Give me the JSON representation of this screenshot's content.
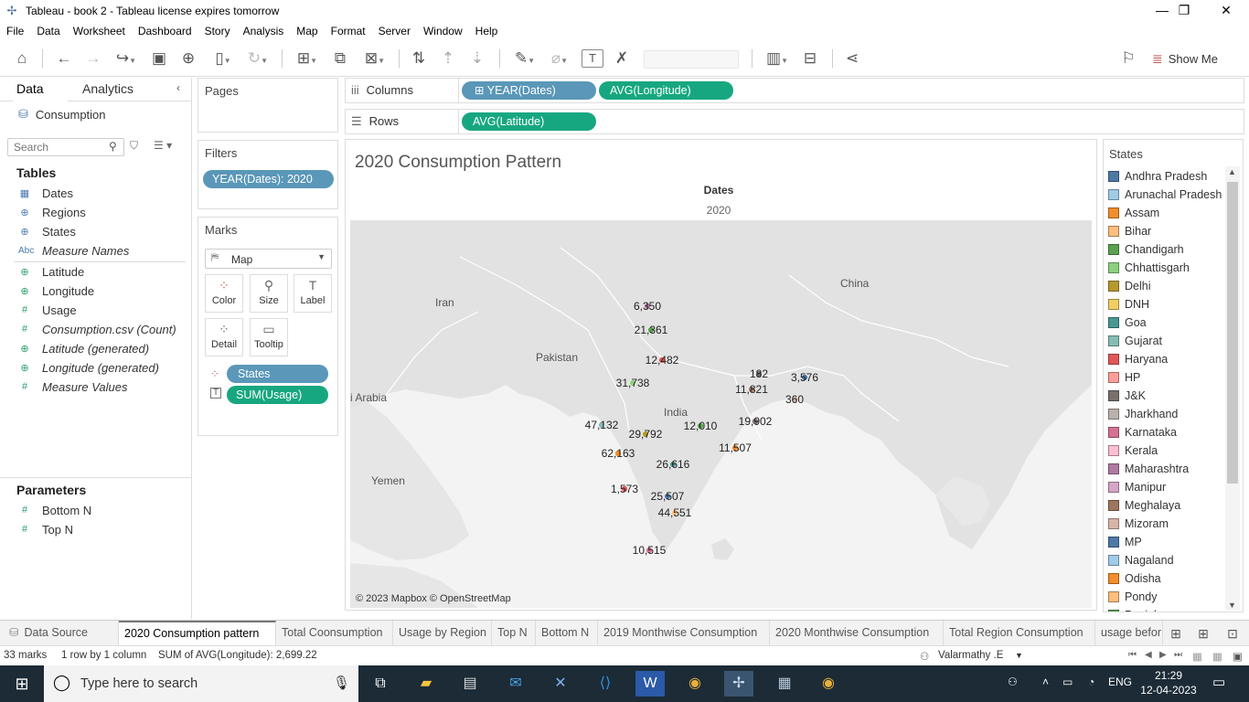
{
  "window": {
    "title": "Tableau - book 2 - Tableau license expires tomorrow",
    "minimize": "—",
    "restore": "❐",
    "close": "✕"
  },
  "menu": [
    "File",
    "Data",
    "Worksheet",
    "Dashboard",
    "Story",
    "Analysis",
    "Map",
    "Format",
    "Server",
    "Window",
    "Help"
  ],
  "toolbar": {
    "show_me": "Show Me"
  },
  "data_pane": {
    "tabs": [
      "Data",
      "Analytics"
    ],
    "source": "Consumption",
    "search_placeholder": "Search",
    "tables_title": "Tables",
    "fields": [
      {
        "name": "Dates",
        "icon": "calendar-icon"
      },
      {
        "name": "Regions",
        "icon": "globe-icon"
      },
      {
        "name": "States",
        "icon": "globe-icon"
      },
      {
        "name": "Measure Names",
        "icon": "abc-icon"
      },
      {
        "name": "Latitude",
        "icon": "globe-icon"
      },
      {
        "name": "Longitude",
        "icon": "globe-icon"
      },
      {
        "name": "Usage",
        "icon": "hash-icon"
      },
      {
        "name": "Consumption.csv (Count)",
        "icon": "hash-icon"
      },
      {
        "name": "Latitude (generated)",
        "icon": "globe-icon"
      },
      {
        "name": "Longitude (generated)",
        "icon": "globe-icon"
      },
      {
        "name": "Measure Values",
        "icon": "hash-icon"
      }
    ],
    "parameters_title": "Parameters",
    "parameters": [
      "Bottom N",
      "Top N"
    ]
  },
  "cards": {
    "pages": "Pages",
    "filters": "Filters",
    "filter_pill": "YEAR(Dates): 2020",
    "marks": "Marks",
    "mark_type": "Map",
    "mark_buttons": [
      "Color",
      "Size",
      "Label",
      "Detail",
      "Tooltip"
    ],
    "mark_pills": [
      "States",
      "SUM(Usage)"
    ]
  },
  "shelves": {
    "columns_label": "Columns",
    "rows_label": "Rows",
    "columns": [
      "YEAR(Dates)",
      "AVG(Longitude)"
    ],
    "rows": [
      "AVG(Latitude)"
    ]
  },
  "viz": {
    "title": "2020 Consumption Pattern",
    "header": "Dates",
    "header_value": "2020",
    "credit": "© 2023 Mapbox © OpenStreetMap",
    "map_labels": [
      "Iran",
      "Pakistan",
      "China",
      "India",
      "i Arabia",
      "Yemen"
    ],
    "marks": [
      {
        "label": "6,350",
        "color": "#b07aa1"
      },
      {
        "label": "21,361",
        "color": "#59a14f"
      },
      {
        "label": "12,482",
        "color": "#e15759"
      },
      {
        "label": "31,738",
        "color": "#8cd17d"
      },
      {
        "label": "182",
        "color": "#79706e"
      },
      {
        "label": "3,576",
        "color": "#4e79a7"
      },
      {
        "label": "11,821",
        "color": "#9d7660"
      },
      {
        "label": "360",
        "color": "#d7b5a6"
      },
      {
        "label": "12,010",
        "color": "#59a14f"
      },
      {
        "label": "19,902",
        "color": "#79706e"
      },
      {
        "label": "47,132",
        "color": "#86bcb6"
      },
      {
        "label": "29,792",
        "color": "#b6992d"
      },
      {
        "label": "62,163",
        "color": "#f28e2b"
      },
      {
        "label": "11,507",
        "color": "#f28e2b"
      },
      {
        "label": "26,616",
        "color": "#499894"
      },
      {
        "label": "1,573",
        "color": "#e15759"
      },
      {
        "label": "25,507",
        "color": "#4e79a7"
      },
      {
        "label": "44,551",
        "color": "#ffbe7d"
      },
      {
        "label": "10,515",
        "color": "#d37295"
      }
    ]
  },
  "legend": {
    "title": "States",
    "items": [
      {
        "name": "Andhra Pradesh",
        "color": "#4e79a7"
      },
      {
        "name": "Arunachal Pradesh",
        "color": "#a0cbe8"
      },
      {
        "name": "Assam",
        "color": "#f28e2b"
      },
      {
        "name": "Bihar",
        "color": "#ffbe7d"
      },
      {
        "name": "Chandigarh",
        "color": "#59a14f"
      },
      {
        "name": "Chhattisgarh",
        "color": "#8cd17d"
      },
      {
        "name": "Delhi",
        "color": "#b6992d"
      },
      {
        "name": "DNH",
        "color": "#f1ce63"
      },
      {
        "name": "Goa",
        "color": "#499894"
      },
      {
        "name": "Gujarat",
        "color": "#86bcb6"
      },
      {
        "name": "Haryana",
        "color": "#e15759"
      },
      {
        "name": "HP",
        "color": "#ff9d9a"
      },
      {
        "name": "J&K",
        "color": "#79706e"
      },
      {
        "name": "Jharkhand",
        "color": "#bab0ac"
      },
      {
        "name": "Karnataka",
        "color": "#d37295"
      },
      {
        "name": "Kerala",
        "color": "#fabfd2"
      },
      {
        "name": "Maharashtra",
        "color": "#b07aa1"
      },
      {
        "name": "Manipur",
        "color": "#d4a6c8"
      },
      {
        "name": "Meghalaya",
        "color": "#9d7660"
      },
      {
        "name": "Mizoram",
        "color": "#d7b5a6"
      },
      {
        "name": "MP",
        "color": "#4e79a7"
      },
      {
        "name": "Nagaland",
        "color": "#a0cbe8"
      },
      {
        "name": "Odisha",
        "color": "#f28e2b"
      },
      {
        "name": "Pondy",
        "color": "#ffbe7d"
      },
      {
        "name": "Punjab",
        "color": "#59a14f"
      }
    ]
  },
  "sheet_tabs": [
    {
      "label": "Data Source",
      "active": false
    },
    {
      "label": "2020 Consumption pattern",
      "active": true
    },
    {
      "label": "Total Coonsumption",
      "active": false
    },
    {
      "label": "Usage by Region",
      "active": false
    },
    {
      "label": "Top N",
      "active": false
    },
    {
      "label": "Bottom N",
      "active": false
    },
    {
      "label": "2019 Monthwise Consumption",
      "active": false
    },
    {
      "label": "2020 Monthwise Consumption",
      "active": false
    },
    {
      "label": "Total Region Consumption",
      "active": false
    },
    {
      "label": "usage befor",
      "active": false
    }
  ],
  "status": {
    "marks": "33 marks",
    "rows_cols": "1 row by 1 column",
    "sum": "SUM of AVG(Longitude): 2,699.22",
    "user": "Valarmathy .E"
  },
  "taskbar": {
    "search_placeholder": "Type here to search",
    "lang": "ENG",
    "time": "21:29",
    "date": "12-04-2023"
  }
}
